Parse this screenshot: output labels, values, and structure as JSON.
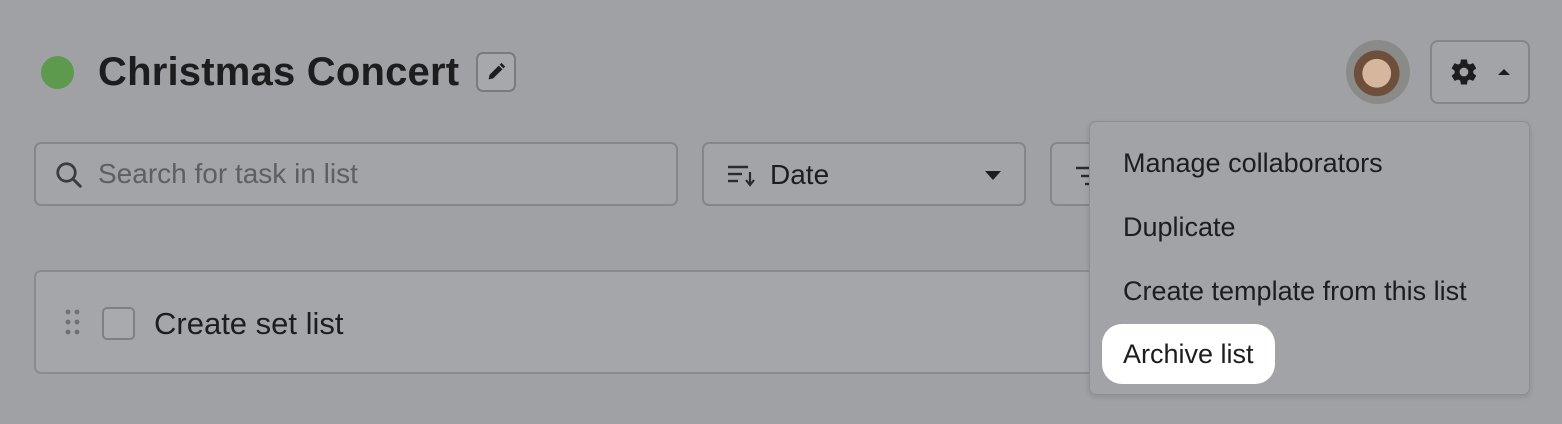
{
  "header": {
    "list_title": "Christmas Concert",
    "status_color": "#5e9a4e",
    "edit_icon": "pencil-icon",
    "avatar_alt": "collaborator avatar",
    "settings_icon": "gear-icon",
    "settings_caret_icon": "caret-up-icon"
  },
  "toolbar": {
    "search": {
      "placeholder": "Search for task in list",
      "value": "",
      "icon": "search-icon"
    },
    "sort": {
      "icon": "sort-icon",
      "selected": "Date",
      "caret_icon": "caret-down-icon"
    },
    "filter": {
      "icon": "filter-icon"
    }
  },
  "tasks": [
    {
      "title": "Create set list",
      "checked": false
    }
  ],
  "settings_menu": {
    "items": [
      {
        "label": "Manage collaborators"
      },
      {
        "label": "Duplicate"
      },
      {
        "label": "Create template from this list"
      },
      {
        "label": "Archive list"
      }
    ],
    "highlighted_index": 3
  }
}
